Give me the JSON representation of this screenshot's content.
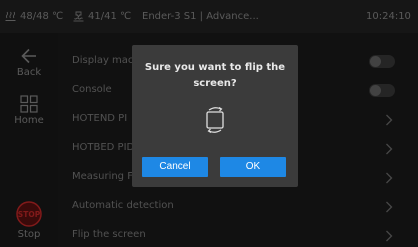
{
  "status_bar": {
    "bed_temp": "48/48 ℃",
    "nozzle_temp": "41/41 ℃",
    "title": "Ender-3 S1 | Advance...",
    "time": "10:24:10"
  },
  "sidebar": {
    "back_label": "Back",
    "home_label": "Home",
    "stop_icon_text": "STOP",
    "stop_label": "Stop"
  },
  "settings": {
    "rows": [
      {
        "label": "Display mac",
        "control": "toggle"
      },
      {
        "label": "Console",
        "control": "toggle"
      },
      {
        "label": "HOTEND PI",
        "control": "chevron"
      },
      {
        "label": "HOTBED PID",
        "control": "chevron"
      },
      {
        "label": "Measuring F",
        "control": "chevron"
      },
      {
        "label": "Automatic detection",
        "control": "chevron"
      },
      {
        "label": "Flip the screen",
        "control": "chevron"
      }
    ]
  },
  "dialog": {
    "title": "Sure you want to flip the screen?",
    "cancel_label": "Cancel",
    "ok_label": "OK"
  },
  "colors": {
    "accent": "#1e88e5",
    "stop_red": "#c62828"
  }
}
